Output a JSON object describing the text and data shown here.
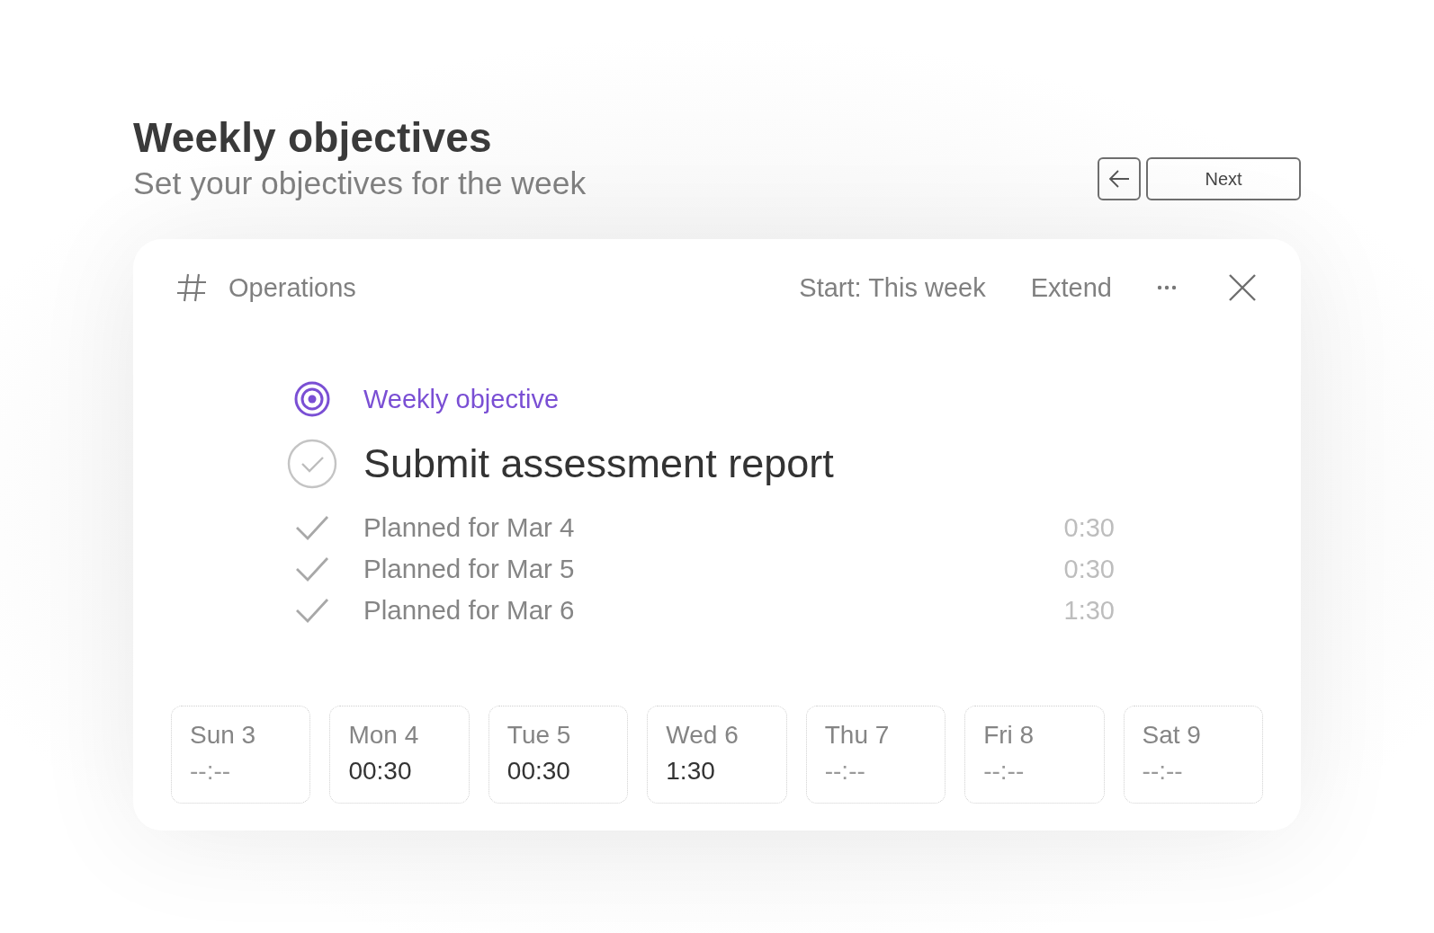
{
  "header": {
    "title": "Weekly objectives",
    "subtitle": "Set your objectives for the week"
  },
  "nav": {
    "next_label": "Next"
  },
  "card": {
    "project": "Operations",
    "start": "Start: This week",
    "extend": "Extend"
  },
  "objective": {
    "label": "Weekly objective",
    "title": "Submit assessment report",
    "completed": false
  },
  "plans": [
    {
      "label": "Planned for Mar 4",
      "time": "0:30"
    },
    {
      "label": "Planned for Mar 5",
      "time": "0:30"
    },
    {
      "label": "Planned for Mar 6",
      "time": "1:30"
    }
  ],
  "days": [
    {
      "label": "Sun 3",
      "time": "--:--",
      "planned": false
    },
    {
      "label": "Mon 4",
      "time": "00:30",
      "planned": true
    },
    {
      "label": "Tue 5",
      "time": "00:30",
      "planned": true
    },
    {
      "label": "Wed 6",
      "time": "1:30",
      "planned": true
    },
    {
      "label": "Thu 7",
      "time": "--:--",
      "planned": false
    },
    {
      "label": "Fri 8",
      "time": "--:--",
      "planned": false
    },
    {
      "label": "Sat 9",
      "time": "--:--",
      "planned": false
    }
  ]
}
